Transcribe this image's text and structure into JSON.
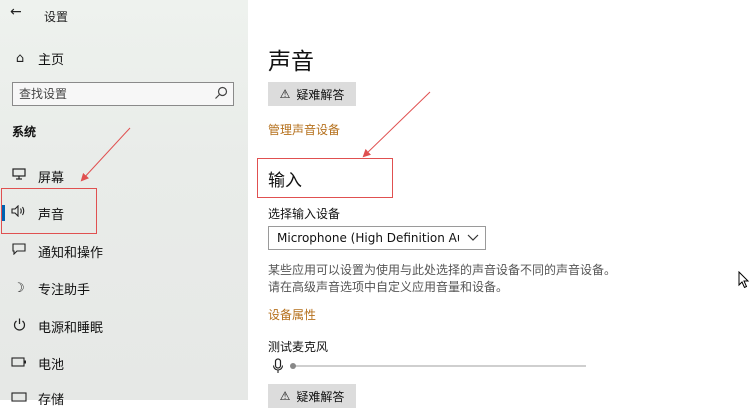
{
  "window": {
    "title": "设置",
    "back_icon": "back-arrow-icon"
  },
  "sidebar": {
    "home": {
      "label": "主页",
      "icon": "home-icon"
    },
    "search": {
      "placeholder": "查找设置",
      "icon": "search-icon"
    },
    "section": "系统",
    "items": [
      {
        "label": "屏幕",
        "icon": "monitor-icon"
      },
      {
        "label": "声音",
        "icon": "speaker-icon",
        "active": true
      },
      {
        "label": "通知和操作",
        "icon": "notification-icon"
      },
      {
        "label": "专注助手",
        "icon": "moon-icon"
      },
      {
        "label": "电源和睡眠",
        "icon": "power-icon"
      },
      {
        "label": "电池",
        "icon": "battery-icon"
      },
      {
        "label": "存储",
        "icon": "storage-icon"
      }
    ]
  },
  "main": {
    "title": "声音",
    "troubleshoot_label": "疑难解答",
    "manage_devices_link": "管理声音设备",
    "input": {
      "heading": "输入",
      "select_label": "选择输入设备",
      "selected_device": "Microphone (High Definition Au...",
      "description": "某些应用可以设置为使用与此处选择的声音设备不同的声音设备。请在高级声音选项中自定义应用音量和设备。",
      "device_properties_link": "设备属性",
      "test_mic_label": "测试麦克风",
      "mic_level": 0
    },
    "troubleshoot_label_2": "疑难解答"
  },
  "colors": {
    "accent": "#0063b1",
    "link": "#b5701c",
    "annotation": "#e05050",
    "button_bg": "#dcdcdc"
  }
}
